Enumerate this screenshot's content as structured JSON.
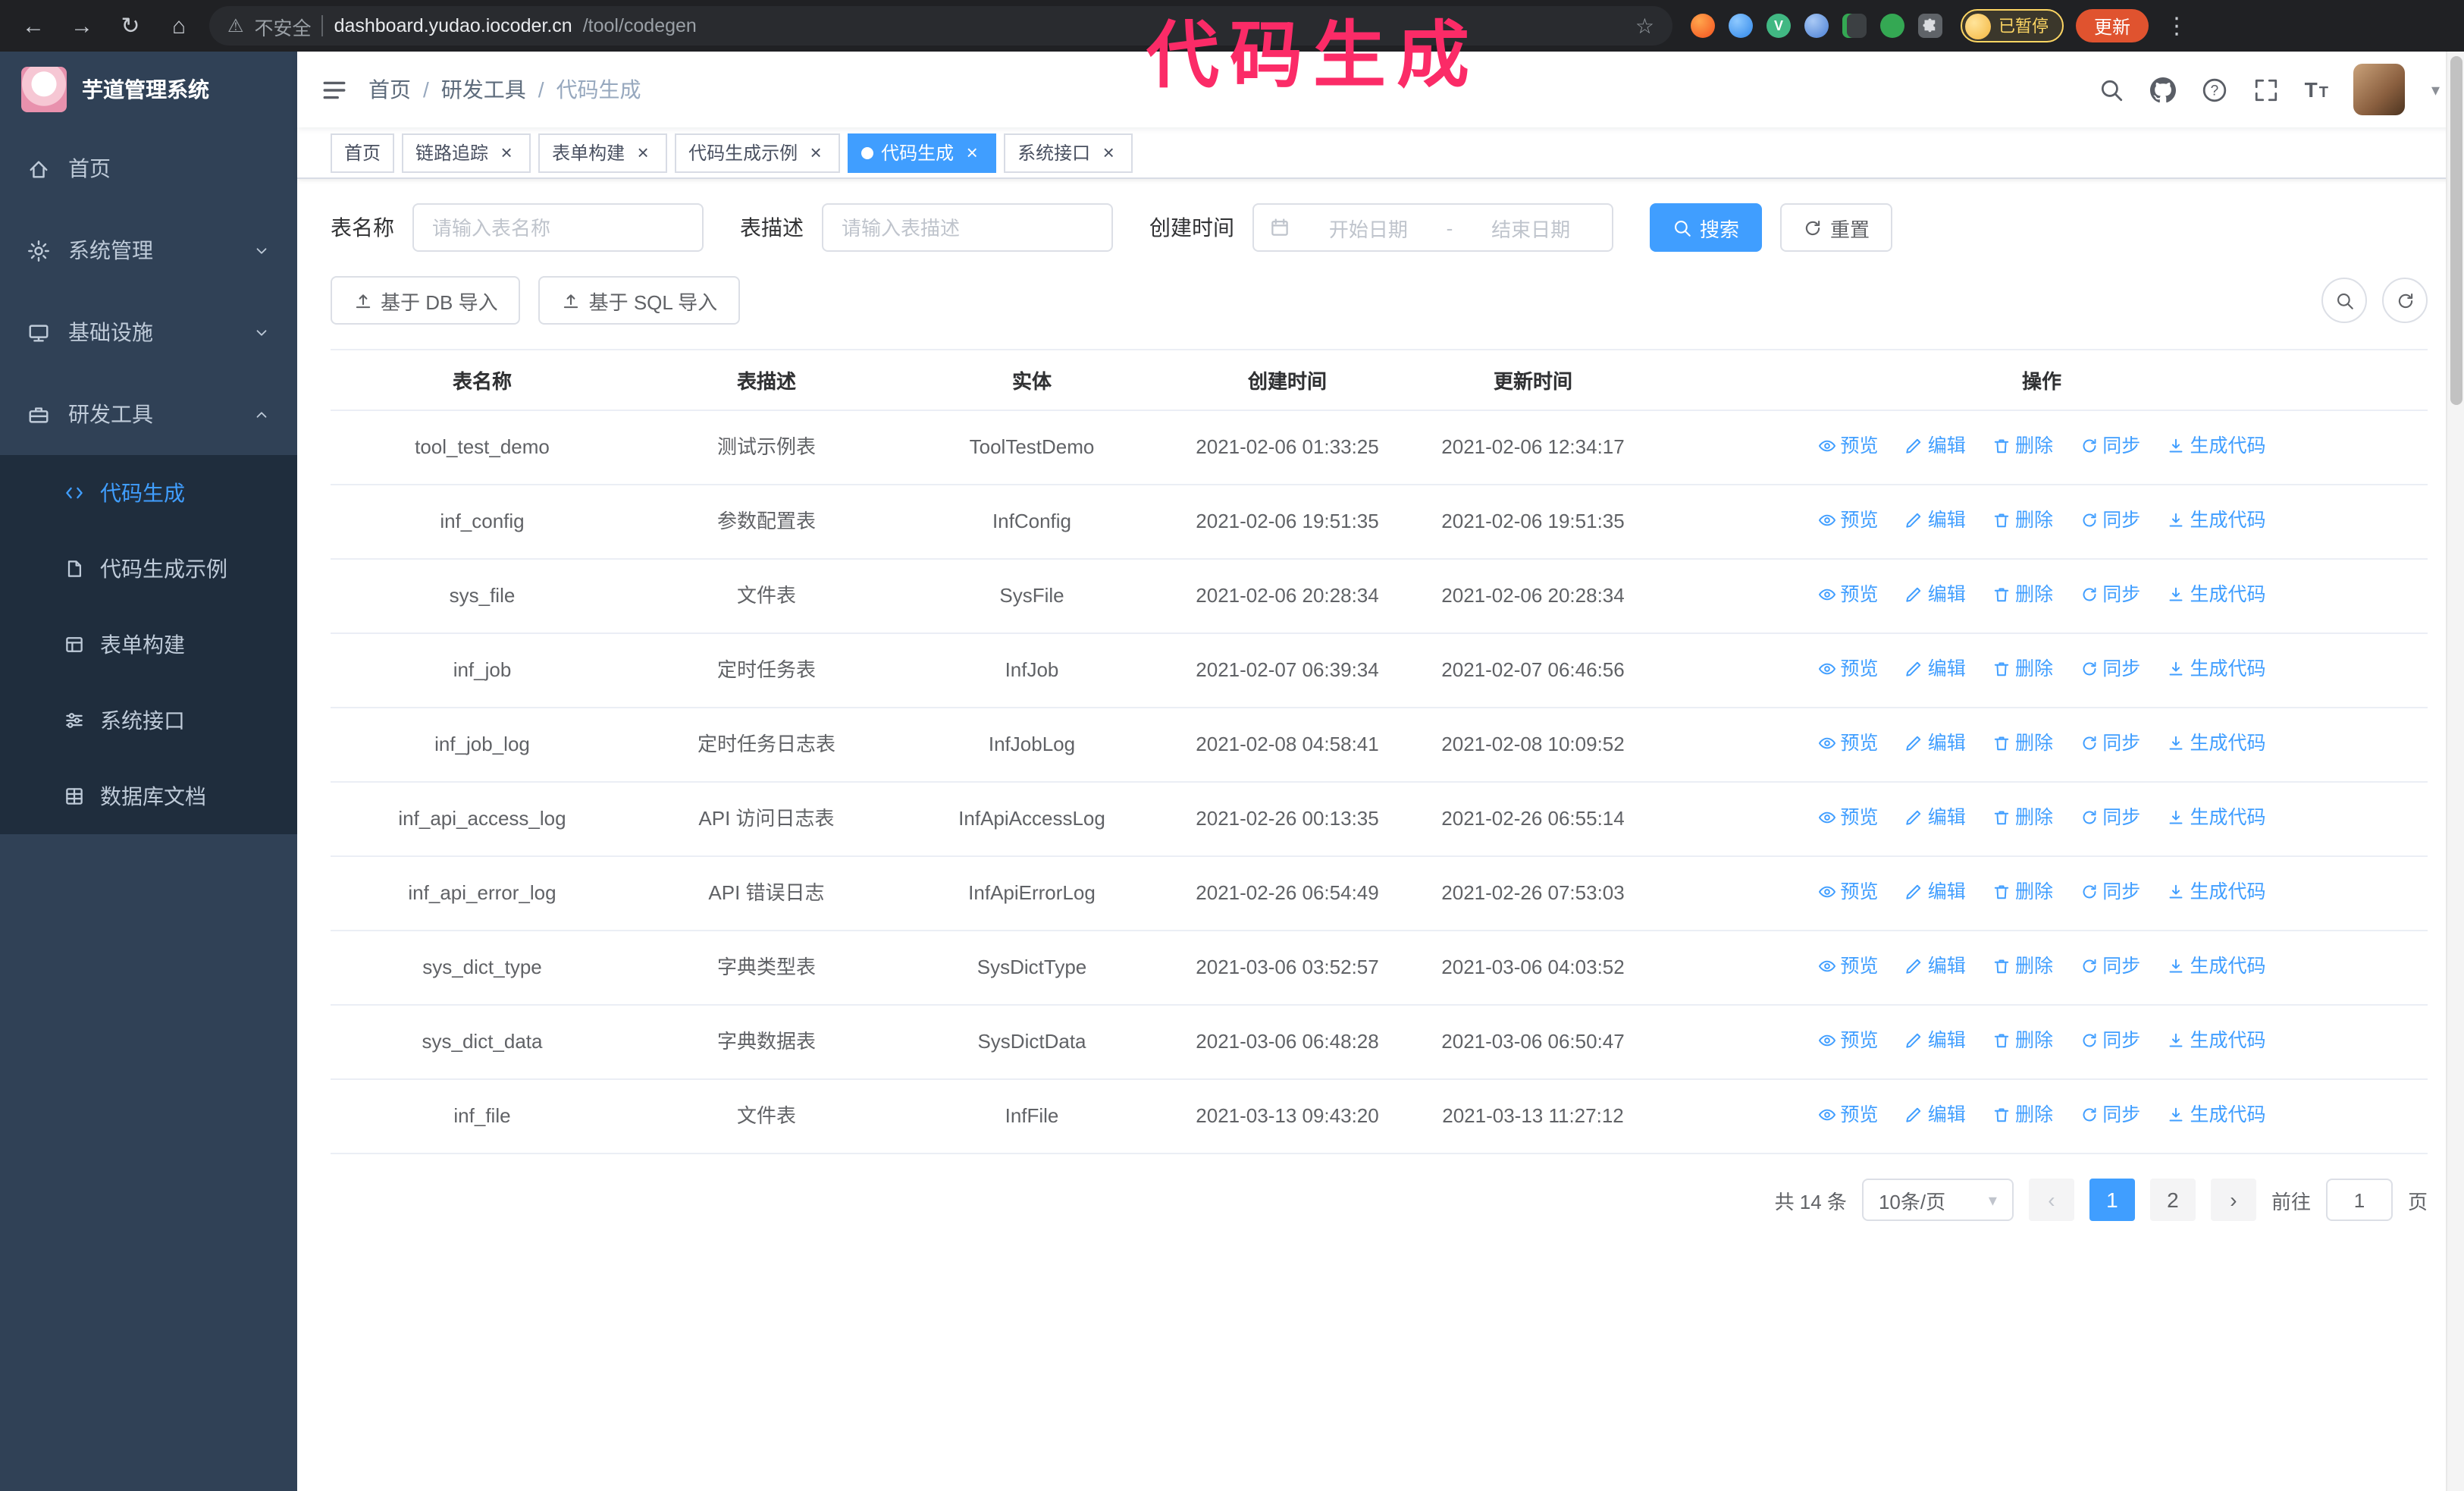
{
  "browser": {
    "security_label": "不安全",
    "url_host": "dashboard.yudao.iocoder.cn",
    "url_path": "/tool/codegen",
    "paused_badge": "已暂停",
    "update_button": "更新"
  },
  "annotation": {
    "text": "代码生成",
    "color": "#fb2b67"
  },
  "icons": {
    "back": "←",
    "forward": "→",
    "reload": "↻",
    "home": "⌂",
    "warning": "⚠",
    "star": "☆",
    "kebab": "⋮",
    "caret_down": "▾",
    "close": "×",
    "prev": "‹",
    "next": "›",
    "url_divider": "|"
  },
  "app": {
    "logo_title": "芋道管理系统",
    "sidebar": {
      "items": [
        {
          "label": "首页"
        },
        {
          "label": "系统管理"
        },
        {
          "label": "基础设施"
        },
        {
          "label": "研发工具"
        }
      ],
      "sub_items": [
        {
          "label": "代码生成",
          "active": true
        },
        {
          "label": "代码生成示例"
        },
        {
          "label": "表单构建"
        },
        {
          "label": "系统接口"
        },
        {
          "label": "数据库文档"
        }
      ]
    },
    "breadcrumb": [
      "首页",
      "研发工具",
      "代码生成"
    ],
    "breadcrumb_separator": "/",
    "tabs": [
      {
        "label": "首页",
        "closable": false
      },
      {
        "label": "链路追踪",
        "closable": true
      },
      {
        "label": "表单构建",
        "closable": true
      },
      {
        "label": "代码生成示例",
        "closable": true
      },
      {
        "label": "代码生成",
        "closable": true,
        "active": true
      },
      {
        "label": "系统接口",
        "closable": true
      }
    ],
    "search_form": {
      "name_label": "表名称",
      "name_placeholder": "请输入表名称",
      "desc_label": "表描述",
      "desc_placeholder": "请输入表描述",
      "time_label": "创建时间",
      "time_start_placeholder": "开始日期",
      "time_separator": "-",
      "time_end_placeholder": "结束日期",
      "search_button": "搜索",
      "reset_button": "重置"
    },
    "toolbar": {
      "import_db_button": "基于 DB 导入",
      "import_sql_button": "基于 SQL 导入"
    },
    "table": {
      "headers": [
        "表名称",
        "表描述",
        "实体",
        "创建时间",
        "更新时间",
        "操作"
      ],
      "ops": [
        "预览",
        "编辑",
        "删除",
        "同步",
        "生成代码"
      ],
      "rows": [
        {
          "name": "tool_test_demo",
          "desc": "测试示例表",
          "entity": "ToolTestDemo",
          "created": "2021-02-06 01:33:25",
          "updated": "2021-02-06 12:34:17"
        },
        {
          "name": "inf_config",
          "desc": "参数配置表",
          "entity": "InfConfig",
          "created": "2021-02-06 19:51:35",
          "updated": "2021-02-06 19:51:35"
        },
        {
          "name": "sys_file",
          "desc": "文件表",
          "entity": "SysFile",
          "created": "2021-02-06 20:28:34",
          "updated": "2021-02-06 20:28:34"
        },
        {
          "name": "inf_job",
          "desc": "定时任务表",
          "entity": "InfJob",
          "created": "2021-02-07 06:39:34",
          "updated": "2021-02-07 06:46:56"
        },
        {
          "name": "inf_job_log",
          "desc": "定时任务日志表",
          "entity": "InfJobLog",
          "created": "2021-02-08 04:58:41",
          "updated": "2021-02-08 10:09:52"
        },
        {
          "name": "inf_api_access_log",
          "desc": "API 访问日志表",
          "entity": "InfApiAccessLog",
          "created": "2021-02-26 00:13:35",
          "updated": "2021-02-26 06:55:14"
        },
        {
          "name": "inf_api_error_log",
          "desc": "API 错误日志",
          "entity": "InfApiErrorLog",
          "created": "2021-02-26 06:54:49",
          "updated": "2021-02-26 07:53:03"
        },
        {
          "name": "sys_dict_type",
          "desc": "字典类型表",
          "entity": "SysDictType",
          "created": "2021-03-06 03:52:57",
          "updated": "2021-03-06 04:03:52"
        },
        {
          "name": "sys_dict_data",
          "desc": "字典数据表",
          "entity": "SysDictData",
          "created": "2021-03-06 06:48:28",
          "updated": "2021-03-06 06:50:47"
        },
        {
          "name": "inf_file",
          "desc": "文件表",
          "entity": "InfFile",
          "created": "2021-03-13 09:43:20",
          "updated": "2021-03-13 11:27:12"
        }
      ]
    },
    "pagination": {
      "total": "共 14 条",
      "page_size": "10条/页",
      "pages": [
        "1",
        "2"
      ],
      "active_page": "1",
      "goto_label": "前往",
      "goto_value": "1",
      "goto_suffix": "页"
    }
  },
  "colors": {
    "accent": "#409eff",
    "sidebar_bg": "#304156",
    "submenu_bg": "#1f2d3d",
    "annotation": "#fb2b67",
    "chrome_bg": "#202124",
    "paused_badge": "#fdd663",
    "update_button_bg": "#e0532f",
    "table_border": "#ebeef5"
  }
}
